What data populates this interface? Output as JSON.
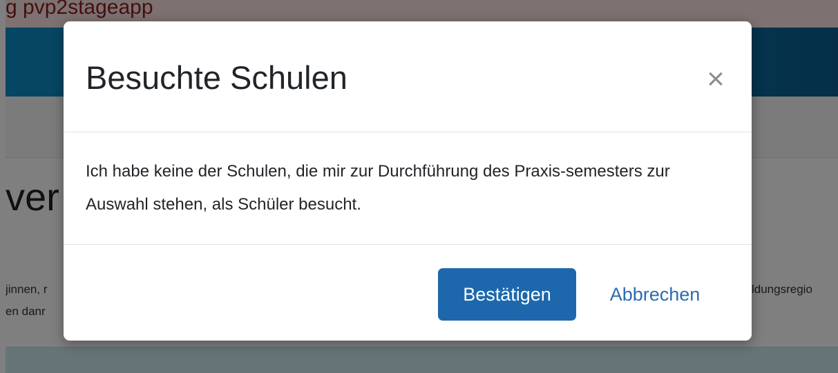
{
  "background": {
    "env_banner": "g pvp2stageapp",
    "page_title_fragment": "ver",
    "intro_line1_left": "jinnen, r",
    "intro_line1_right": "ldungsregio",
    "intro_line2_left": "en danr"
  },
  "modal": {
    "title": "Besuchte Schulen",
    "close_symbol": "×",
    "body_text": "Ich habe keine der Schulen, die mir zur Durchführung des Praxis-semesters zur Auswahl stehen, als Schüler besucht.",
    "confirm_label": "Bestätigen",
    "cancel_label": "Abbrechen"
  },
  "colors": {
    "primary": "#1d68ad",
    "link": "#2b6cb0",
    "header_blue": "#0c7ab4",
    "banner_text": "#8a1f1f"
  },
  "icons": {
    "close": "close-icon"
  }
}
